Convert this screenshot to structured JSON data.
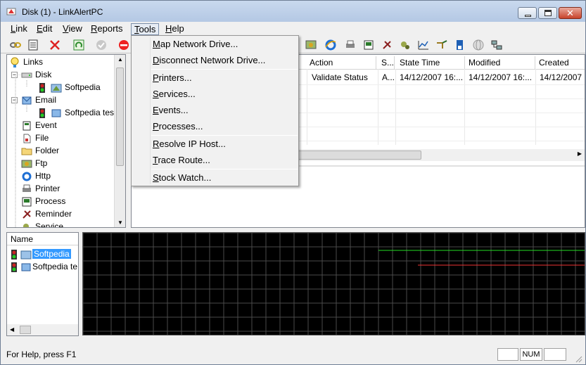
{
  "window": {
    "title": "Disk (1) - LinkAlertPC"
  },
  "menubar": {
    "items": [
      "Link",
      "Edit",
      "View",
      "Reports",
      "Tools",
      "Help"
    ]
  },
  "tools_menu": {
    "items": [
      "Map Network Drive...",
      "Disconnect Network Drive...",
      "Printers...",
      "Services...",
      "Events...",
      "Processes...",
      "Resolve IP Host...",
      "Trace Route...",
      "Stock Watch..."
    ]
  },
  "tree": {
    "root": "Links",
    "items": [
      {
        "label": "Disk",
        "icon": "disk-icon"
      },
      {
        "label": "Softpedia",
        "icon": "traffic-light-icon"
      },
      {
        "label": "Email",
        "icon": "email-icon"
      },
      {
        "label": "Softpedia test",
        "icon": "traffic-light-icon"
      },
      {
        "label": "Event",
        "icon": "event-icon"
      },
      {
        "label": "File",
        "icon": "file-icon"
      },
      {
        "label": "Folder",
        "icon": "folder-icon"
      },
      {
        "label": "Ftp",
        "icon": "ftp-icon"
      },
      {
        "label": "Http",
        "icon": "ie-icon"
      },
      {
        "label": "Printer",
        "icon": "printer-icon"
      },
      {
        "label": "Process",
        "icon": "process-icon"
      },
      {
        "label": "Reminder",
        "icon": "reminder-icon"
      },
      {
        "label": "Service",
        "icon": "service-icon"
      }
    ]
  },
  "table": {
    "columns": [
      "Action",
      "S...",
      "State Time",
      "Modified",
      "Created"
    ],
    "rows": [
      [
        "Validate Status",
        "A...",
        "14/12/2007 16:...",
        "14/12/2007 16:...",
        "14/12/2007"
      ]
    ]
  },
  "name_list": {
    "header": "Name",
    "items": [
      "Softpedia",
      "Softpedia te"
    ]
  },
  "status": {
    "help_text": "For Help, press F1",
    "num": "NUM"
  },
  "colors": {
    "graph_bg": "#000000",
    "grid": "#4a4a4a",
    "series_green": "#22dd22",
    "series_red": "#ee3333",
    "selection": "#3399ff"
  }
}
